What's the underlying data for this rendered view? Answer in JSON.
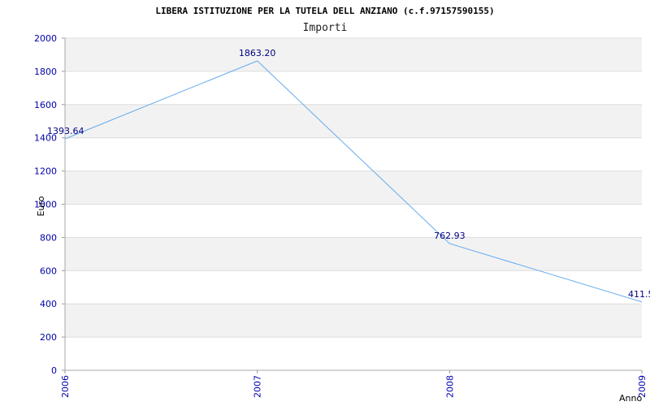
{
  "chart_data": {
    "type": "line",
    "title": "LIBERA ISTITUZIONE PER LA TUTELA DELL ANZIANO (c.f.97157590155)",
    "subtitle": "Importi",
    "xlabel": "Anno",
    "ylabel": "Euro",
    "categories": [
      "2006",
      "2007",
      "2008",
      "2009"
    ],
    "values": [
      1393.64,
      1863.2,
      762.93,
      411.5
    ],
    "value_labels": [
      "1393.64",
      "1863.20",
      "762.93",
      "411.5"
    ],
    "ylim": [
      0,
      2000
    ],
    "yticks": [
      0,
      200,
      400,
      600,
      800,
      1000,
      1200,
      1400,
      1600,
      1800,
      2000
    ],
    "grid": true,
    "band_color": "#f2f2f2",
    "line_color": "#66aaee",
    "tick_color": "#0000aa"
  }
}
